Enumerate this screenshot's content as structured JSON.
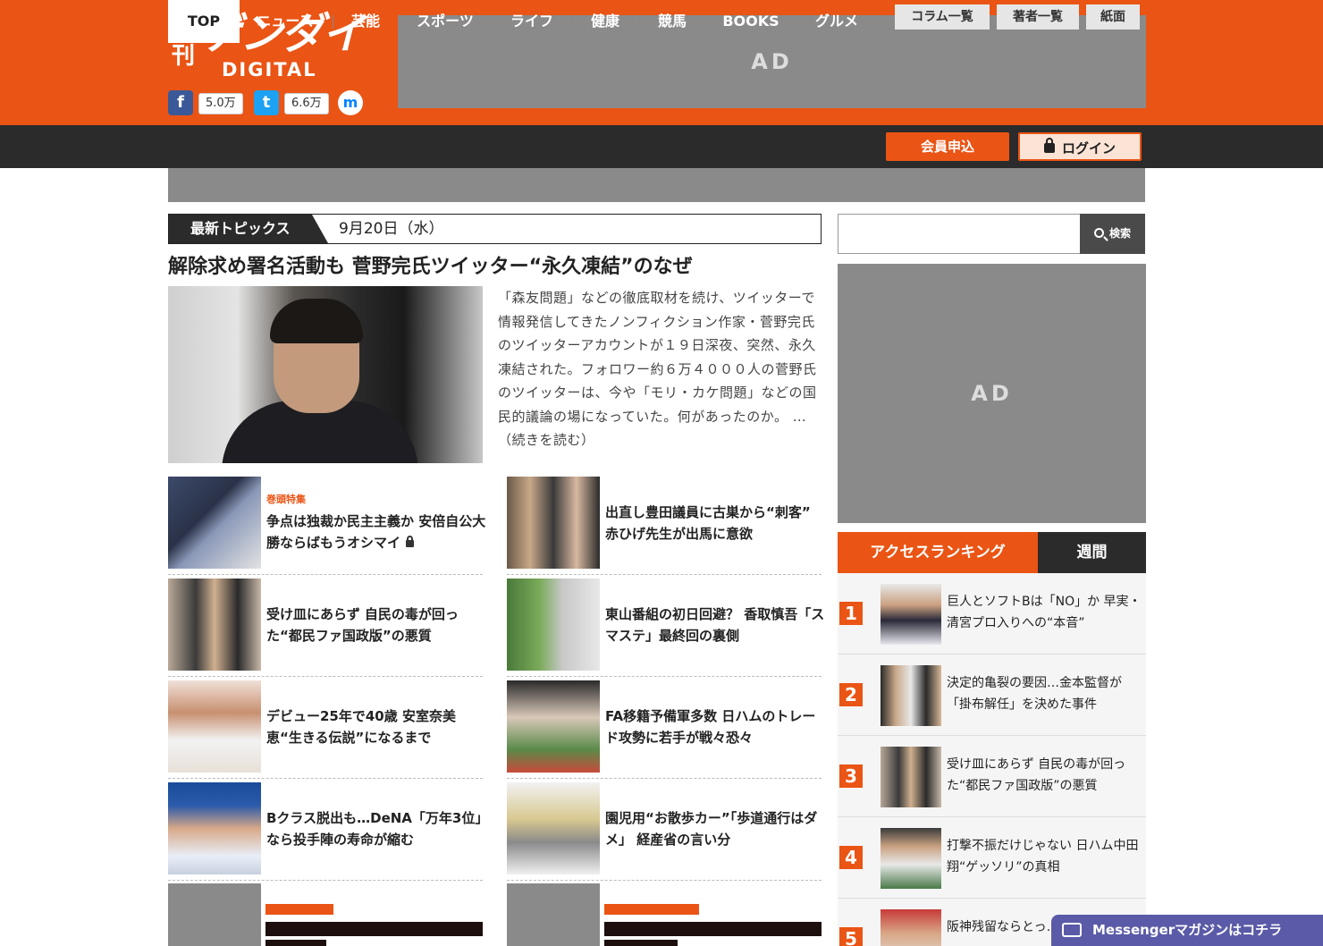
{
  "brand": {
    "nikkan": "日刊",
    "gendai": "ゲンダイ",
    "digital": "DIGITAL"
  },
  "social": {
    "facebook_icon": "f",
    "facebook_count": "5.0万",
    "twitter_icon": "t",
    "twitter_count": "6.6万",
    "messenger_icon": "m"
  },
  "ads": {
    "top": "AD",
    "side": "AD"
  },
  "nav": {
    "items": [
      "TOP",
      "ニュース",
      "芸能",
      "スポーツ",
      "ライフ",
      "健康",
      "競馬",
      "BOOKS",
      "グルメ"
    ],
    "join": "会員申込",
    "login": "ログイン"
  },
  "subnav": [
    "コラム一覧",
    "著者一覧",
    "紙面"
  ],
  "topics": {
    "label": "最新トピックス",
    "date": "9月20日（水）"
  },
  "lead": {
    "headline": "解除求め署名活動も 菅野完氏ツイッター“永久凍結”のなぜ",
    "text": "「森友問題」などの徹底取材を続け、ツイッターで情報発信してきたノンフィクション作家・菅野完氏のツイッターアカウントが１９日深夜、突然、永久凍結された。フォロワー約６万４０００人の菅野氏のツイッターは、今や「モリ・カケ問題」などの国民的議論の場になっていた。何があったのか。 …（続きを読む）"
  },
  "articles": [
    {
      "tag": "巻頭特集",
      "title": "争点は独裁か民主主義か 安倍自公大勝ならばもうオシマイ"
    },
    {
      "tag": "",
      "title": "出直し豊田議員に古巣から“刺客” 赤ひげ先生が出馬に意欲"
    },
    {
      "tag": "",
      "title": "受け皿にあらず 自民の毒が回った“都民ファ国政版”の悪質"
    },
    {
      "tag": "",
      "title": "東山番組の初日回避？ 香取慎吾「スマステ」最終回の裏側"
    },
    {
      "tag": "",
      "title": "デビュー25年で40歳 安室奈美恵“生きる伝説”になるまで"
    },
    {
      "tag": "",
      "title": "FA移籍予備軍多数 日ハムのトレード攻勢に若手が戦々恐々"
    },
    {
      "tag": "",
      "title": "Bクラス脱出も…DeNA「万年3位」なら投手陣の寿命が縮む"
    },
    {
      "tag": "",
      "title": "園児用“お散歩カー”「歩道通行はダメ」 経産省の言い分"
    }
  ],
  "search": {
    "button": "検索",
    "placeholder": ""
  },
  "ranking": {
    "tab_access": "アクセスランキング",
    "tab_week": "週間",
    "items": [
      {
        "num": "1",
        "title": "巨人とソフトBは「NO」か 早実・清宮プロ入りへの“本音”"
      },
      {
        "num": "2",
        "title": "決定的亀裂の要因…金本監督が「掛布解任」を決めた事件"
      },
      {
        "num": "3",
        "title": "受け皿にあらず 自民の毒が回った“都民ファ国政版”の悪質"
      },
      {
        "num": "4",
        "title": "打撃不振だけじゃない 日ハム中田翔“ゲッソリ”の真相"
      },
      {
        "num": "5",
        "title": "阪神残留ならとっ…"
      }
    ]
  },
  "messenger": {
    "label": "Messengerマガジンはコチラ"
  }
}
